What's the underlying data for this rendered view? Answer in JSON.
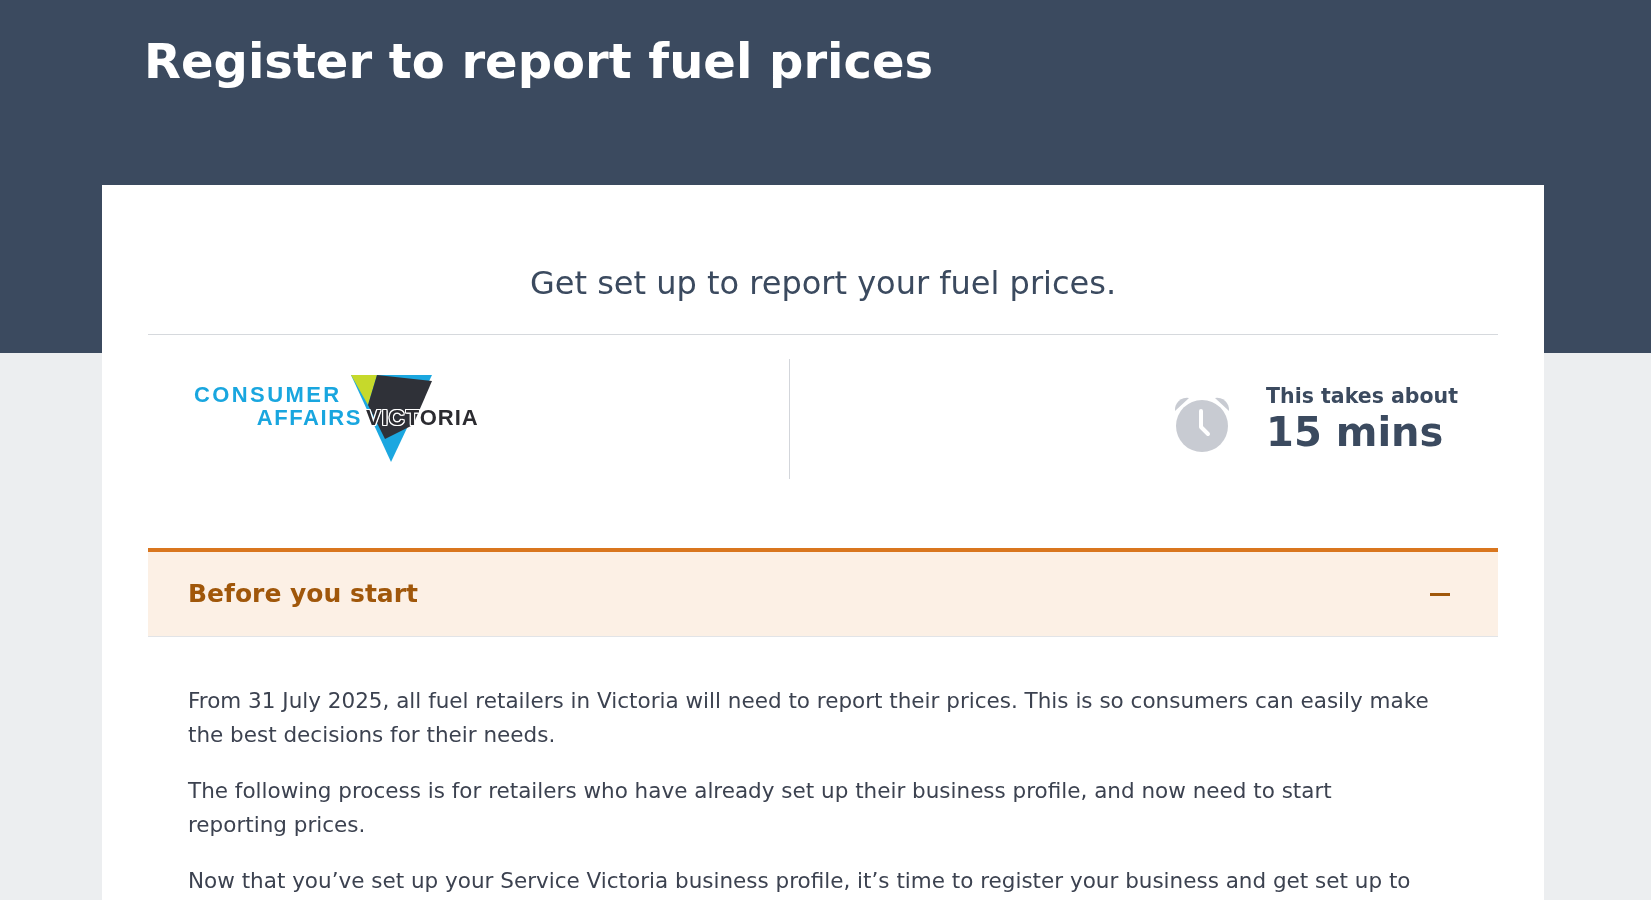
{
  "header": {
    "title": "Register to report fuel prices"
  },
  "card": {
    "subtitle": "Get set up to report your fuel prices.",
    "logo": {
      "words": [
        "CONSUMER",
        "AFFAIRS",
        "VICTORIA"
      ]
    },
    "duration": {
      "label": "This takes about",
      "value": "15 mins"
    },
    "accordion": {
      "title": "Before you start",
      "expanded": true,
      "paragraphs": [
        "From 31 July 2025, all fuel retailers in Victoria will need to report their prices. This is so consumers can easily make the best decisions for their needs.",
        "The following process is for retailers who have already set up their business profile, and now need to start reporting prices.",
        "Now that you’ve set up your Service Victoria business profile, it’s time to register your business and get set up to"
      ]
    }
  }
}
